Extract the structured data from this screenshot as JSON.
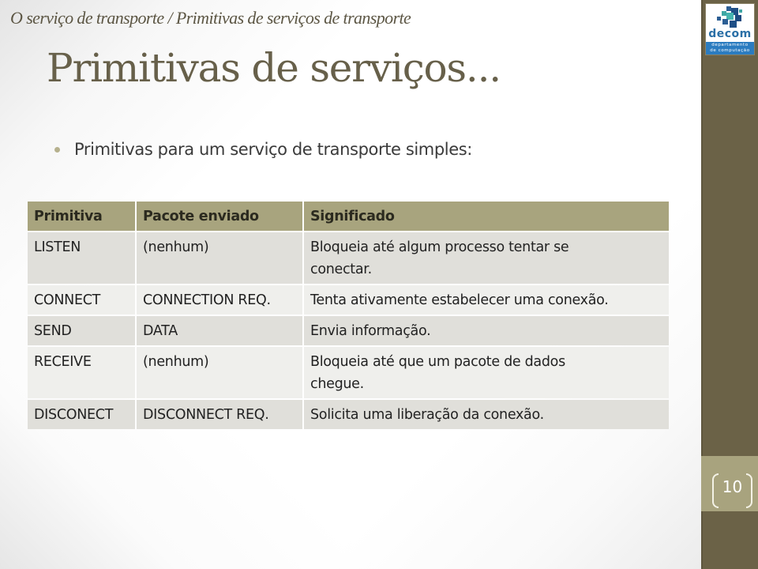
{
  "slide": {
    "breadcrumb": "O serviço de transporte / Primitivas de serviços de transporte",
    "title": "Primitivas de serviços...",
    "bullet": "Primitivas para um serviço de transporte simples:",
    "page_number": "10"
  },
  "logo": {
    "icon": "decom-squares-logo-icon",
    "word": "decom",
    "subtitle_line1": "departamento",
    "subtitle_line2": "de computação"
  },
  "table": {
    "headers": [
      "Primitiva",
      "Pacote enviado",
      "Significado"
    ],
    "rows": [
      [
        "LISTEN",
        "(nenhum)",
        "Bloqueia até algum processo tentar se conectar."
      ],
      [
        "CONNECT",
        "CONNECTION REQ.",
        "Tenta ativamente estabelecer uma conexão."
      ],
      [
        "SEND",
        "DATA",
        "Envia informação."
      ],
      [
        "RECEIVE",
        "(nenhum)",
        "Bloqueia até que um pacote de dados chegue."
      ],
      [
        "DISCONECT",
        "DISCONNECT REQ.",
        "Solicita uma liberação da conexão."
      ]
    ]
  },
  "colors": {
    "accent_band": "#6b6247",
    "header_fill": "#a8a47e",
    "row_dark": "#e0dfda",
    "row_light": "#efefec",
    "logo_blue": "#2b7cc0"
  }
}
